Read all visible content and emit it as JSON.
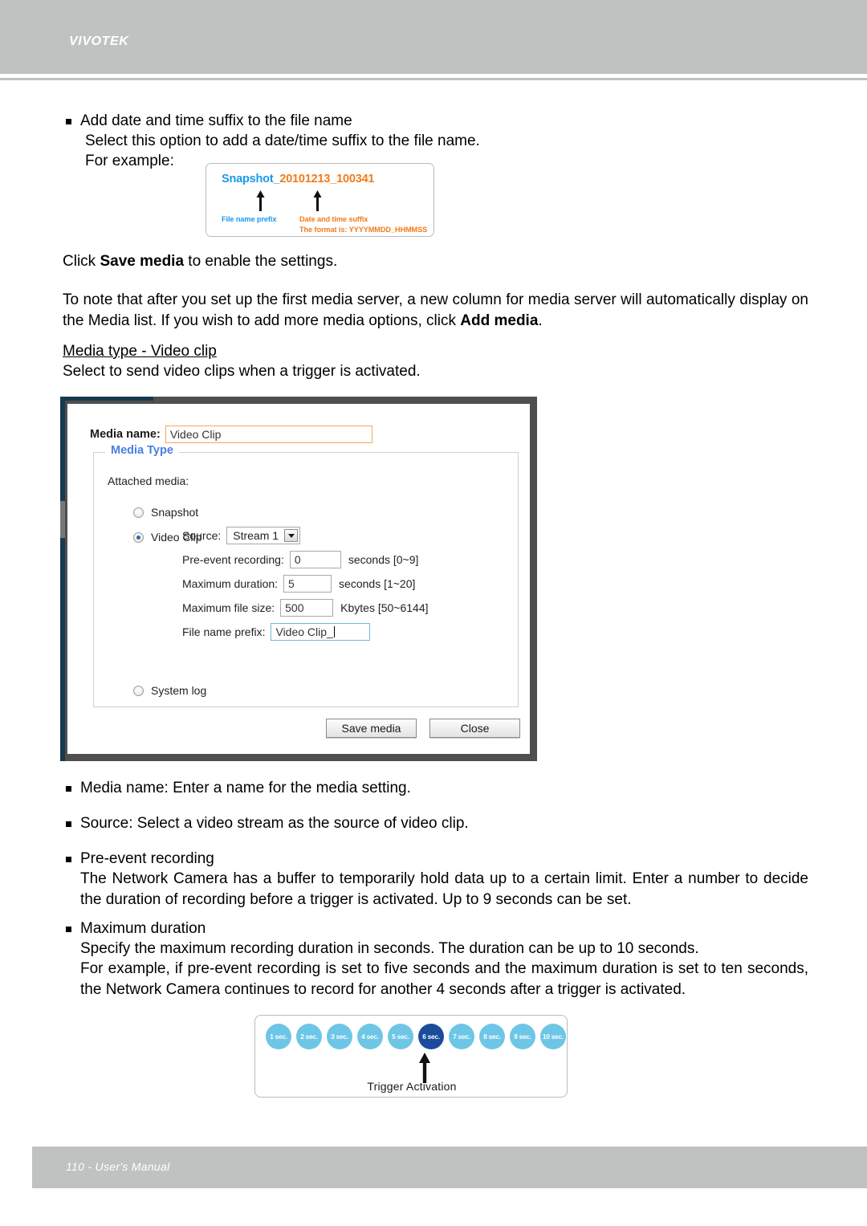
{
  "header": {
    "brand": "VIVOTEK"
  },
  "footer": {
    "text": "110 - User's Manual"
  },
  "body": {
    "b1_title": "Add date and time suffix to the file name",
    "b1_l1": "Select this option to add a date/time suffix to the file name.",
    "b1_l2": "For example:",
    "p_click_save_pre": "Click ",
    "p_click_save_bold": "Save media",
    "p_click_save_post": " to enable the settings.",
    "p_note_pre": "To note that after you set up the first media server, a new column for media server will automatically display on the Media list.  If you wish to add more media options, click ",
    "p_note_bold": "Add media",
    "p_note_post": ".",
    "h_media_type": "Media type - Video clip",
    "p_media_type_sub": "Select to send video clips when a trigger is activated.",
    "b2": "Media name: Enter a name for the media setting.",
    "b3": "Source: Select a video stream as the source of video clip.",
    "b4_title": "Pre-event recording",
    "b4_l1": "The Network Camera has a buffer to temporarily hold data up to a certain limit. Enter a number to decide the duration of recording before a trigger is activated. Up to 9 seconds can be set.",
    "b5_title": "Maximum duration",
    "b5_l1": "Specify the maximum recording duration in seconds. The duration can be up to 10 seconds.",
    "b5_l2": "For example, if pre-event recording is set to five seconds and the maximum duration is set to ten seconds, the Network Camera continues to record for another 4 seconds after a trigger is activated."
  },
  "snapshot_example": {
    "prefix": "Snapshot_",
    "suffix": "20101213_100341",
    "caption_prefix": "File name prefix",
    "caption_suffix_l1": "Date and time suffix",
    "caption_suffix_l2": "The format is: YYYYMMDD_HHMMSS",
    "color_prefix": "#1b9ae8",
    "color_suffix": "#f07c1b"
  },
  "dialog": {
    "media_name_label": "Media name:",
    "media_name_value": "Video Clip",
    "fieldset_legend": "Media Type",
    "attached_media_label": "Attached media:",
    "radio_snapshot": "Snapshot",
    "radio_video_clip": "Video Clip",
    "radio_system_log": "System log",
    "selected_radio": "Video Clip",
    "source_label": "Source:",
    "source_value": "Stream 1",
    "source_options": [
      "Stream 1"
    ],
    "pre_event_label": "Pre-event recording:",
    "pre_event_value": "0",
    "pre_event_unit": "seconds [0~9]",
    "max_duration_label": "Maximum duration:",
    "max_duration_value": "5",
    "max_duration_unit": "seconds [1~20]",
    "max_filesize_label": "Maximum file size:",
    "max_filesize_value": "500",
    "max_filesize_unit": "Kbytes [50~6144]",
    "file_prefix_label": "File name prefix:",
    "file_prefix_value": "Video Clip_",
    "save_button": "Save media",
    "close_button": "Close",
    "accent_color": "#4a7fe0",
    "focus_border_color": "#f0a95c"
  },
  "timeline": {
    "caption": "Trigger Activation",
    "highlight_index": 5,
    "color_normal": "#6ec6e6",
    "color_highlight": "#1b4b9b",
    "circles": [
      "1 sec.",
      "2 sec.",
      "3 sec.",
      "4 sec.",
      "5 sec.",
      "6 sec.",
      "7 sec.",
      "8 sec.",
      "9 sec.",
      "10 sec."
    ]
  }
}
